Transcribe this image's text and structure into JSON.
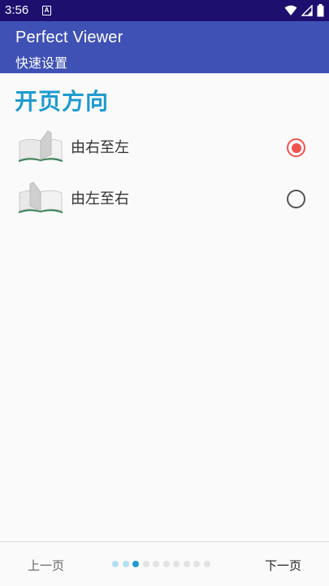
{
  "status_bar": {
    "time": "3:56",
    "notification_icon": "A",
    "icons": [
      "wifi-icon",
      "signal-icon",
      "battery-icon"
    ]
  },
  "app_bar": {
    "title": "Perfect Viewer",
    "subtitle": "快速设置"
  },
  "section": {
    "title": "开页方向"
  },
  "options": [
    {
      "label": "由右至左",
      "icon": "book-right-to-left-icon",
      "selected": true
    },
    {
      "label": "由左至右",
      "icon": "book-left-to-right-icon",
      "selected": false
    }
  ],
  "footer": {
    "prev_label": "上一页",
    "next_label": "下一页",
    "pager": {
      "total": 10,
      "current": 3
    }
  },
  "colors": {
    "status_bar": "#1d0f6e",
    "app_bar": "#3f51b5",
    "accent": "#1e9bd0",
    "radio_selected": "#ef5350"
  }
}
